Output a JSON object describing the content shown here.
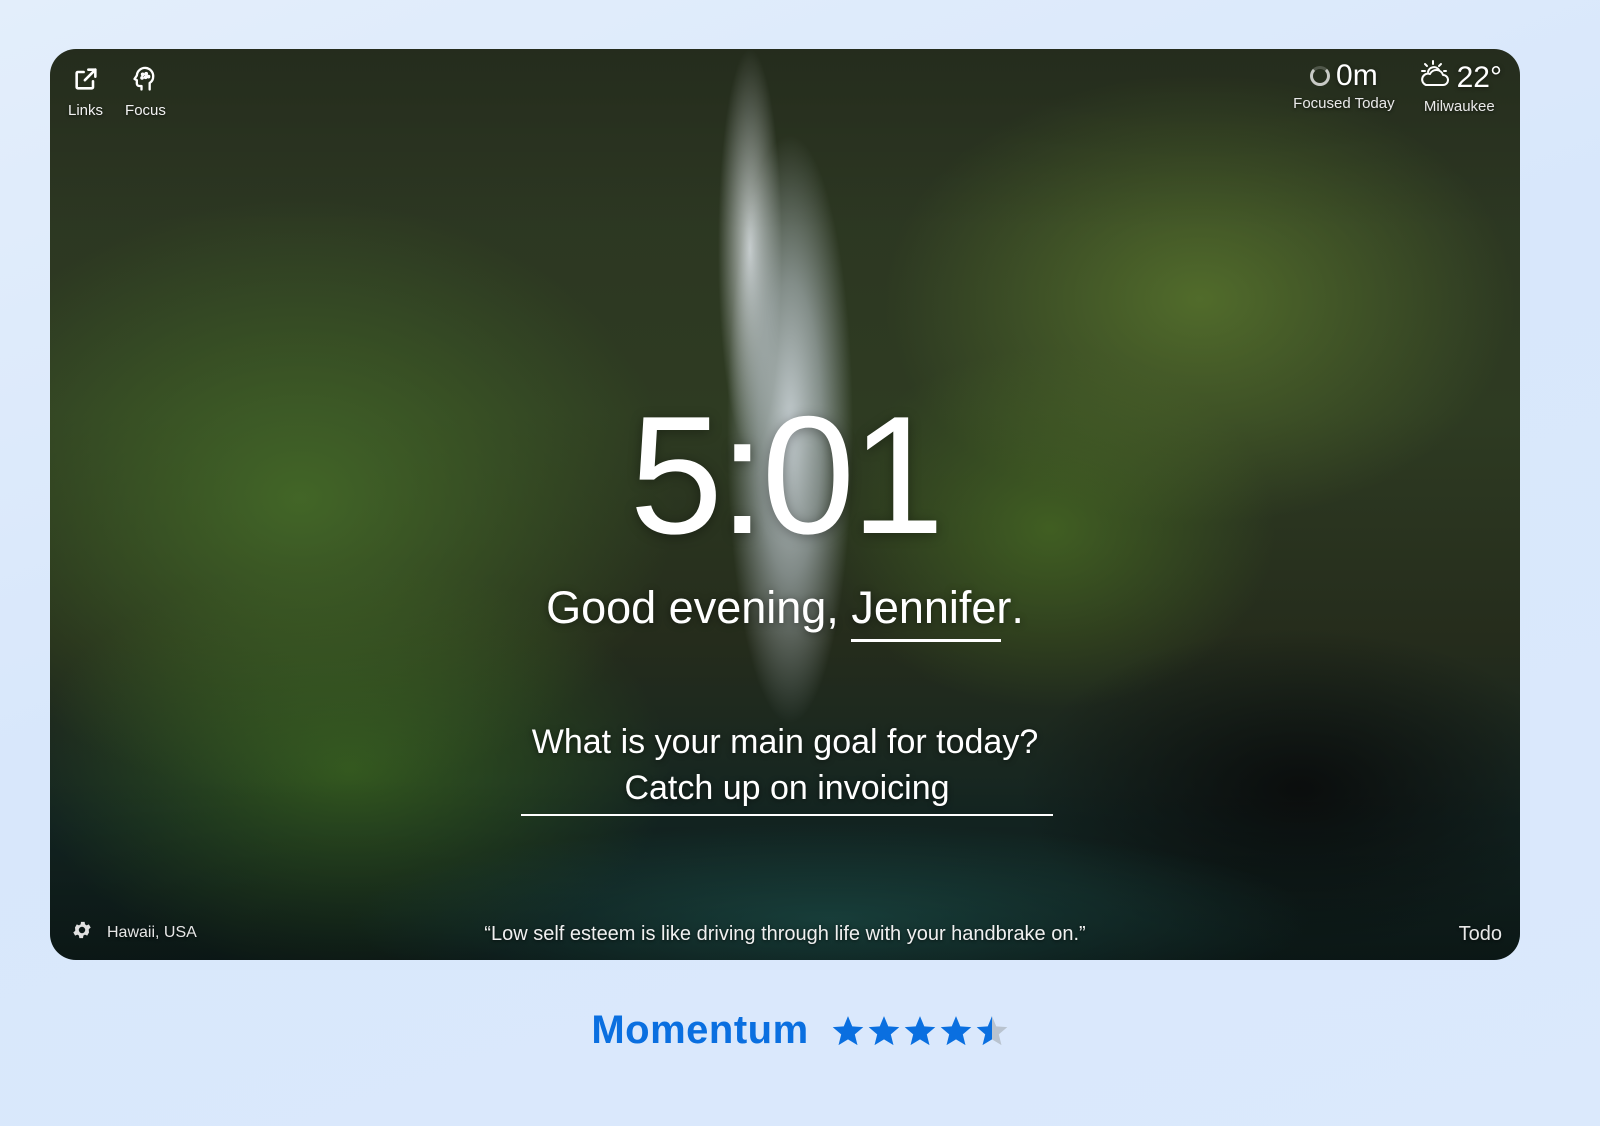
{
  "top_left": {
    "links": {
      "label": "Links",
      "icon": "external-link-icon"
    },
    "focus": {
      "label": "Focus",
      "icon": "head-brain-icon"
    }
  },
  "top_right": {
    "focus_time": {
      "value": "0m",
      "label": "Focused Today",
      "icon": "progress-ring-icon"
    },
    "weather": {
      "value": "22°",
      "label": "Milwaukee",
      "icon": "partly-cloudy-icon"
    }
  },
  "clock": {
    "time": "5:01"
  },
  "greeting": {
    "prefix": "Good evening, ",
    "name": "Jennifer",
    "suffix": "."
  },
  "goal": {
    "question": "What is your main goal for today?",
    "value": "Catch up on invoicing"
  },
  "bottom": {
    "settings_icon": "gear-icon",
    "location": "Hawaii, USA",
    "quote": "“Low self esteem is like driving through life with your handbrake on.”",
    "todo_label": "Todo"
  },
  "caption": {
    "brand": "Momentum",
    "rating": 4.5,
    "rating_max": 5,
    "colors": {
      "brand": "#0a6fe0",
      "star_filled": "#0a6fe0",
      "star_empty": "#b9c3cf"
    }
  }
}
